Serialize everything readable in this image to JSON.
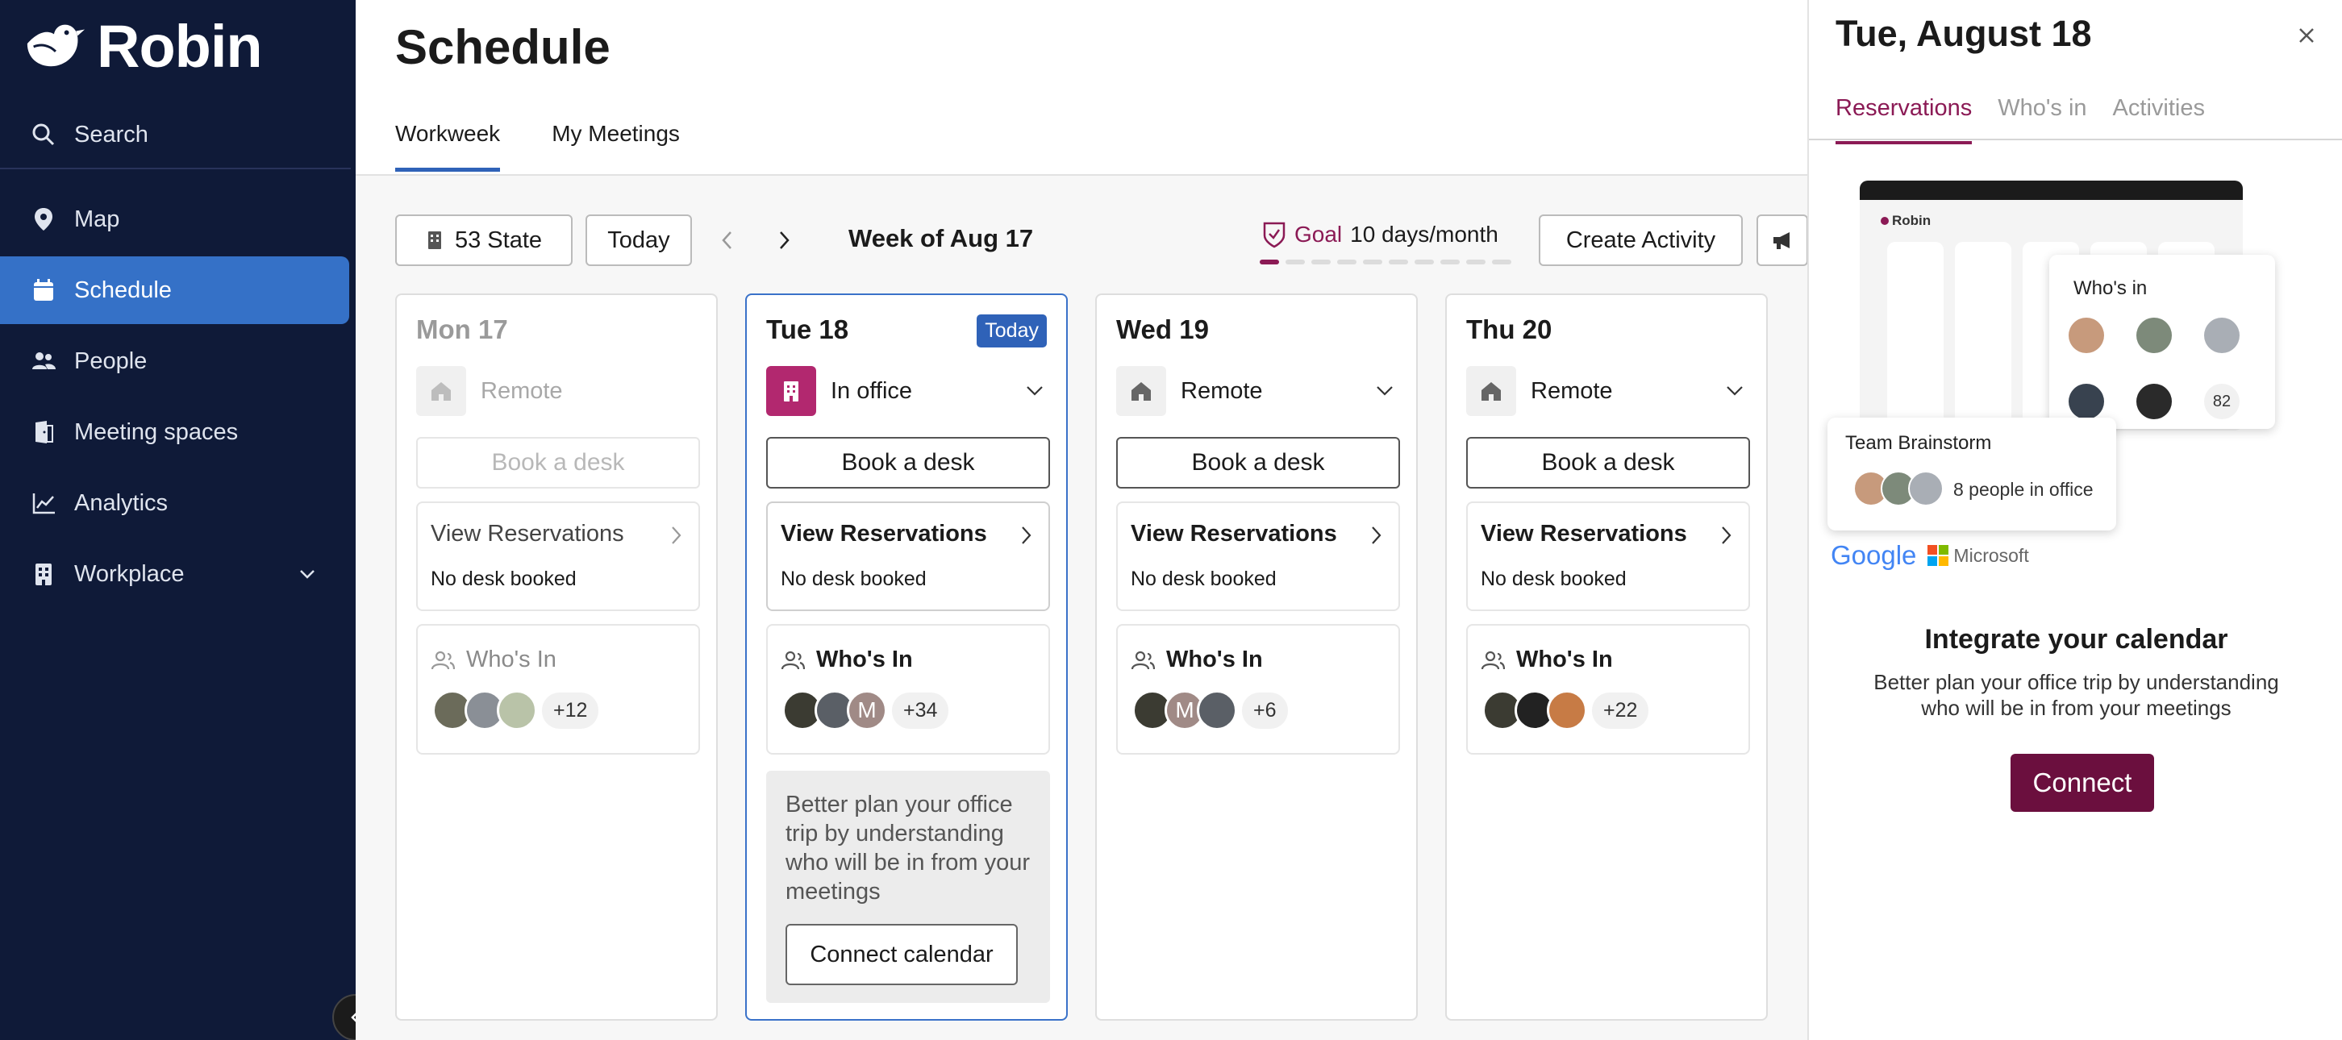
{
  "brand": {
    "name": "Robin"
  },
  "sidebar": {
    "search_label": "Search",
    "items": [
      {
        "label": "Map",
        "icon": "map-pin-icon"
      },
      {
        "label": "Schedule",
        "icon": "calendar-icon",
        "active": true
      },
      {
        "label": "People",
        "icon": "people-icon"
      },
      {
        "label": "Meeting spaces",
        "icon": "meeting-spaces-icon"
      },
      {
        "label": "Analytics",
        "icon": "analytics-icon"
      },
      {
        "label": "Workplace",
        "icon": "building-icon",
        "expandable": true
      }
    ]
  },
  "header": {
    "title": "Schedule"
  },
  "tabs": [
    {
      "label": "Workweek",
      "active": true
    },
    {
      "label": "My Meetings"
    }
  ],
  "toolbar": {
    "location": "53 State",
    "today": "Today",
    "week_label": "Week of Aug 17",
    "goal_label": "Goal",
    "goal_value": "10 days/month",
    "goal_progress": {
      "completed": 1,
      "total": 10
    },
    "create_activity": "Create Activity"
  },
  "days": [
    {
      "name": "Mon 17",
      "status": "Remote",
      "book": "Book a desk",
      "view_reservations": "View Reservations",
      "reservation_status": "No desk booked",
      "whos_in": "Who's In",
      "count": "+12"
    },
    {
      "name": "Tue 18",
      "badge": "Today",
      "status": "In office",
      "book": "Book a desk",
      "view_reservations": "View Reservations",
      "reservation_status": "No desk booked",
      "whos_in": "Who's In",
      "avatar_initial": "M",
      "count": "+34",
      "promo": {
        "text": "Better plan your office trip by understanding who will be in from your meetings",
        "button": "Connect calendar"
      }
    },
    {
      "name": "Wed 19",
      "status": "Remote",
      "book": "Book a desk",
      "view_reservations": "View Reservations",
      "reservation_status": "No desk booked",
      "whos_in": "Who's In",
      "avatar_initial": "M",
      "count": "+6"
    },
    {
      "name": "Thu 20",
      "status": "Remote",
      "book": "Book a desk",
      "view_reservations": "View Reservations",
      "reservation_status": "No desk booked",
      "whos_in": "Who's In",
      "count": "+22"
    }
  ],
  "panel": {
    "date": "Tue, August 18",
    "tabs": [
      {
        "label": "Reservations",
        "active": true
      },
      {
        "label": "Who's in"
      },
      {
        "label": "Activities"
      }
    ],
    "illustration": {
      "brand": "Robin",
      "whos_in_title": "Who's in",
      "whos_in_count": "82",
      "meeting_title": "Team Brainstorm",
      "meeting_sub": "8 people in office",
      "providers": [
        "Google",
        "Microsoft"
      ]
    },
    "integrate_title": "Integrate your calendar",
    "integrate_desc": "Better plan your office trip by understanding who will be in from your meetings",
    "connect": "Connect"
  },
  "colors": {
    "sidebar": "#0f1a38",
    "active_nav": "#3571c7",
    "brand_accent": "#8b1a55",
    "connect_button": "#6b0f3e",
    "today_border": "#3a72c9"
  }
}
